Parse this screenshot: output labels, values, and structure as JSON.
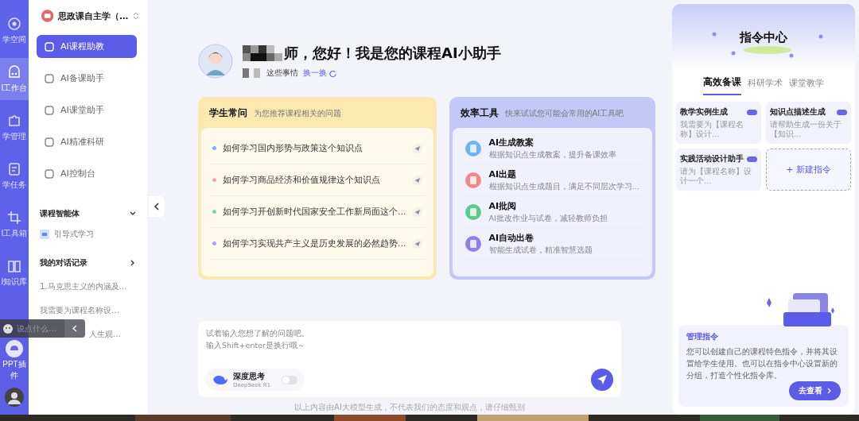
{
  "rail": {
    "items": [
      {
        "label": "学空间",
        "selected": false
      },
      {
        "label": "I工作台",
        "selected": true
      },
      {
        "label": "学管理",
        "selected": false
      },
      {
        "label": "学任务",
        "selected": false
      },
      {
        "label": "I工具箱",
        "selected": false
      },
      {
        "label": "I知识库",
        "selected": false
      }
    ],
    "plugin": "PPT插件"
  },
  "sidebar": {
    "course": "思政课自主学（…",
    "items": [
      {
        "label": "AI课程助教",
        "selected": true
      },
      {
        "label": "AI备课助手",
        "selected": false
      },
      {
        "label": "AI课堂助手",
        "selected": false
      },
      {
        "label": "AI精准科研",
        "selected": false
      },
      {
        "label": "AI控制台",
        "selected": false
      }
    ],
    "agents": {
      "title": "课程智能体",
      "expanded": true,
      "items": [
        "引导式学习"
      ]
    },
    "history": {
      "title": "我的对话记录",
      "expanded": false,
      "items": [
        "1.马克思主义的内涵及…",
        "我需要为课程名称设…",
        "人生观…"
      ]
    }
  },
  "floating_chat": {
    "placeholder": "说点什么…"
  },
  "greeting": {
    "title": "师，您好！我是您的课程AI小助手",
    "subtitle": "这些事情",
    "refresh": "换一换"
  },
  "faq": {
    "title": "学生常问",
    "subtitle": "为您推荐课程相关的问题",
    "items": [
      {
        "text": "如何学习国内形势与政策这个知识点",
        "color": "#7fb0ea"
      },
      {
        "text": "如何学习商品经济和价值规律这个知识点",
        "color": "#f0a3b4"
      },
      {
        "text": "如何学习开创新时代国家安全工作新局面这个…",
        "color": "#7fd3a8"
      },
      {
        "text": "如何学习实现共产主义是历史发展的必然趋势…",
        "color": "#aaa2ee"
      }
    ]
  },
  "tools": {
    "title": "效率工具",
    "subtitle": "快来试试您可能会常用的AI工具吧",
    "items": [
      {
        "name": "AI生成教案",
        "desc": "根据知识点生成教案，提升备课效率",
        "color": "#6fb4f2"
      },
      {
        "name": "AI出题",
        "desc": "根据知识点生成题目，满足不同层次学习…",
        "color": "#f08a8a"
      },
      {
        "name": "AI批阅",
        "desc": "AI批改作业与试卷，减轻教师负担",
        "color": "#5cc98f"
      },
      {
        "name": "AI自动出卷",
        "desc": "智能生成试卷，精准智慧选题",
        "color": "#8f7fe6"
      }
    ]
  },
  "composer": {
    "placeholder": [
      "试着输入您想了解的问题吧。",
      "输入Shift+enter是换行哦～"
    ],
    "deep_think": {
      "label": "深度思考",
      "model": "DeepSeek R1",
      "on": false
    }
  },
  "disclaimer": "以上内容由AI大模型生成，不代表我们的态度和观点，请仔细甄别",
  "command_center": {
    "title": "指令中心",
    "tabs": [
      {
        "label": "高效备课",
        "selected": true
      },
      {
        "label": "科研学术",
        "selected": false
      },
      {
        "label": "课堂教学",
        "selected": false
      }
    ],
    "cards": [
      {
        "title": "教学实例生成",
        "desc": "我需要为【课程名称】设计…"
      },
      {
        "title": "知识点描述生成",
        "desc": "请帮助生成一份关于【知识…"
      },
      {
        "title": "实践活动设计助手",
        "desc": "请为【课程名称】设计一个…"
      }
    ],
    "new_command": "+ 新建指令",
    "manage": {
      "title": "管理指令",
      "text": "您可以创建自己的课程特色指令，并将其设置给学生使用。也可以在指令中心设置新的分组，打造个性化指令库。",
      "button": "去查看"
    }
  }
}
